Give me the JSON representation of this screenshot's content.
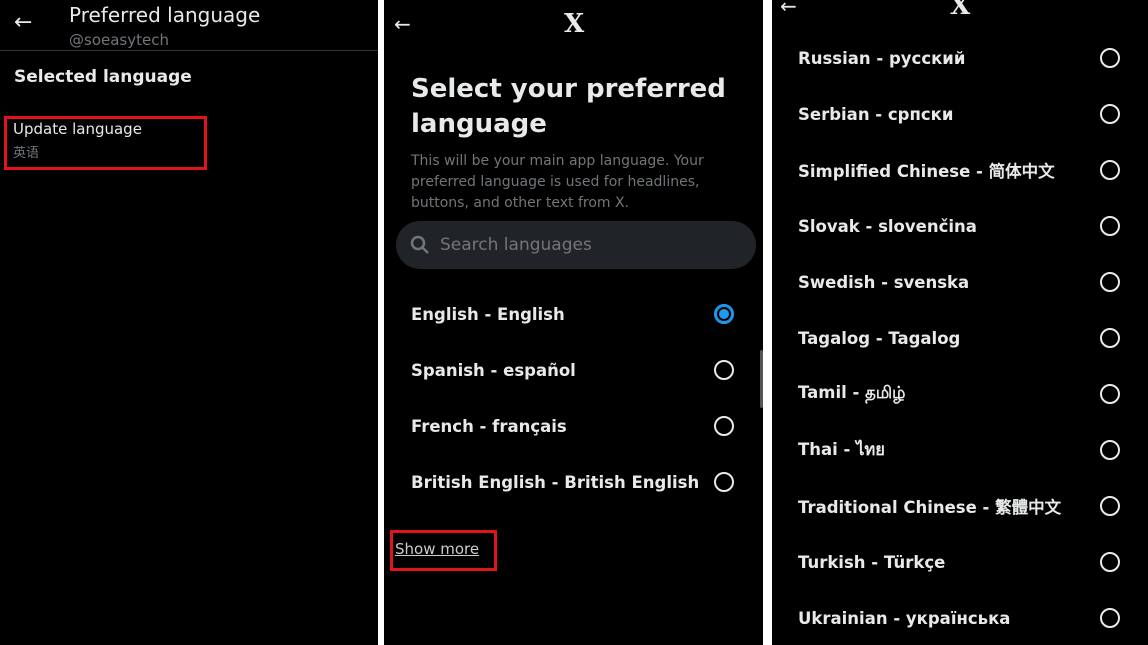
{
  "panel1": {
    "title": "Preferred language",
    "handle": "@soeasytech",
    "section_heading": "Selected language",
    "update_label": "Update language",
    "current_value": "英语"
  },
  "panel2": {
    "logo": "X",
    "heading": "Select your preferred language",
    "description": "This will be your main app language. Your preferred language is used for headlines, buttons, and other text from X.",
    "search_placeholder": "Search languages",
    "languages": [
      {
        "label": "English - English",
        "selected": true
      },
      {
        "label": "Spanish - español",
        "selected": false
      },
      {
        "label": "French - français",
        "selected": false
      },
      {
        "label": "British English - British English",
        "selected": false
      }
    ],
    "show_more": "Show more"
  },
  "panel3": {
    "logo": "X",
    "languages": [
      {
        "label": "Russian - русский"
      },
      {
        "label": "Serbian - српски"
      },
      {
        "label": "Simplified Chinese - 简体中文"
      },
      {
        "label": "Slovak - slovenčina"
      },
      {
        "label": "Swedish - svenska"
      },
      {
        "label": "Tagalog - Tagalog"
      },
      {
        "label": "Tamil - தமிழ்"
      },
      {
        "label": "Thai - ไทย"
      },
      {
        "label": "Traditional Chinese - 繁體中文"
      },
      {
        "label": "Turkish - Türkçe"
      },
      {
        "label": "Ukrainian - українська"
      }
    ]
  },
  "colors": {
    "accent": "#1d9bf0",
    "highlight": "#e0141a",
    "background": "#000000"
  }
}
